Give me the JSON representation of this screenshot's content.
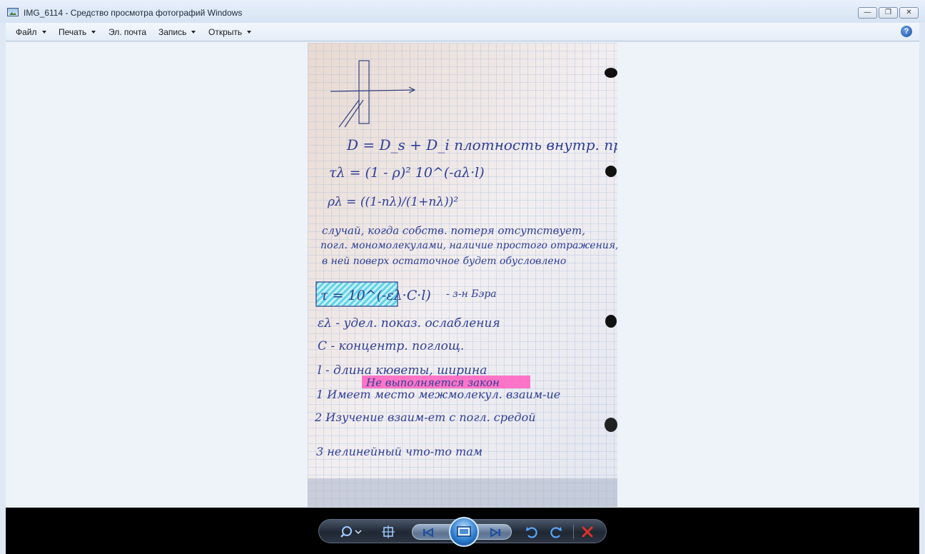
{
  "window": {
    "title": "IMG_6114 - Средство просмотра фотографий Windows",
    "buttons": [
      "minimize-button",
      "restore-button",
      "close-button"
    ]
  },
  "menubar": {
    "items": [
      {
        "label": "Файл",
        "has_dropdown": true
      },
      {
        "label": "Печать",
        "has_dropdown": true
      },
      {
        "label": "Эл. почта",
        "has_dropdown": false
      },
      {
        "label": "Запись",
        "has_dropdown": true
      },
      {
        "label": "Открыть",
        "has_dropdown": true
      }
    ],
    "help_icon": "help-icon"
  },
  "photo": {
    "notes": {
      "line1": "D = D_s + D_i  плотность внутр. пропуск.",
      "line2": "τλ = (1 - ρ)² 10^(-aλ·l)",
      "line3": "ρλ = ((1-nλ)/(1+nλ))²",
      "para1": "случай, когда собств. потеря отсутствует,",
      "para2": "погл. мономолекулами, наличие простого отражения,",
      "para3": "в ней поверх остаточное будет обусловлено",
      "formula": "τ = 10^(-ελ·C·l)",
      "formula_note": "- з-н Бэра",
      "def1": "ελ - удел. показ. ослабления",
      "def2": "C - концентр. поглощ.",
      "def3": "l - длина кюветы, ширина",
      "highlight": "Не выполняется закон",
      "item1": "1 Имеет место межмолекул. взаим-ие",
      "item2": "2 Изучение взаим-ет с погл. средой",
      "item3": "3 нелинейный что-то там"
    }
  },
  "toolbar": {
    "icons": [
      "zoom-icon",
      "actual-size-icon",
      "previous-icon",
      "slideshow-icon",
      "next-icon",
      "rotate-left-icon",
      "rotate-right-icon",
      "delete-icon"
    ]
  },
  "colors": {
    "titlebar": "#dbe6f4",
    "viewer_bg": "#eef3fa",
    "toolbar_bg": "#000000",
    "ink": "#2a3b8f",
    "highlight_pink": "#ff4fb8",
    "highlight_cyan": "#59d4e8",
    "delete_red": "#e0302a"
  }
}
